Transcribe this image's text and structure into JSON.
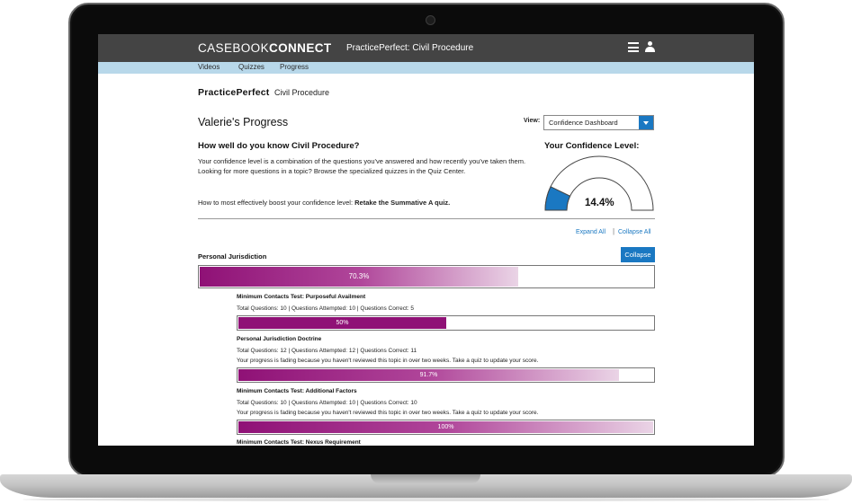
{
  "app": {
    "brand_light": "CASEBOOK",
    "brand_bold": "CONNECT",
    "page_title": "PracticePerfect: Civil Procedure"
  },
  "nav": {
    "items": [
      "Videos",
      "Quizzes",
      "Progress"
    ]
  },
  "header": {
    "title": "PracticePerfect",
    "subtitle": "Civil Procedure"
  },
  "progress": {
    "title": "Valerie's Progress",
    "view_label": "View:",
    "view_value": "Confidence Dashboard",
    "question_heading": "How well do you know Civil Procedure?",
    "description": "Your confidence level is a combination of the questions you've answered and how recently you've taken them. Looking for more questions in a topic? Browse the specialized quizzes in the Quiz Center.",
    "boost_prefix": "How to most effectively boost your confidence level: ",
    "boost_action": "Retake the Summative A quiz."
  },
  "confidence": {
    "title": "Your Confidence Level:",
    "value_text": "14.4%",
    "value": 0.144
  },
  "controls": {
    "expand_all": "Expand All",
    "separator": "|",
    "collapse_all": "Collapse All"
  },
  "section": {
    "title": "Personal Jurisdiction",
    "collapse_label": "Collapse",
    "percent_text": "70.3%",
    "percent": 0.703
  },
  "topics": [
    {
      "title": "Minimum Contacts Test: Purposeful Availment",
      "stats": "Total Questions: 10  |  Questions Attempted: 10  |  Questions Correct: 5",
      "note": "",
      "percent_text": "50%",
      "percent": 0.5,
      "faded": false
    },
    {
      "title": "Personal Jurisdiction Doctrine",
      "stats": "Total Questions: 12  |  Questions Attempted: 12  |  Questions Correct: 11",
      "note": "Your progress is fading because you haven't reviewed this topic in over two weeks. Take a quiz to update your score.",
      "percent_text": "91.7%",
      "percent": 0.917,
      "faded": true
    },
    {
      "title": "Minimum Contacts Test: Additional Factors",
      "stats": "Total Questions: 10  |  Questions Attempted: 10  |  Questions Correct: 10",
      "note": "Your progress is fading because you haven't reviewed this topic in over two weeks. Take a quiz to update your score.",
      "percent_text": "100%",
      "percent": 1.0,
      "faded": true
    },
    {
      "title": "Minimum Contacts Test: Nexus Requirement",
      "stats": "",
      "note": "",
      "percent_text": "",
      "percent": null,
      "faded": false
    }
  ],
  "colors": {
    "accent_blue": "#1a78c2",
    "progress_purple": "#8f1176",
    "header_gray": "#444444",
    "subnav_blue": "#b8d8ea"
  },
  "icons": {
    "menu": "hamburger-menu-icon",
    "user": "user-icon",
    "dropdown": "chevron-down-icon"
  }
}
